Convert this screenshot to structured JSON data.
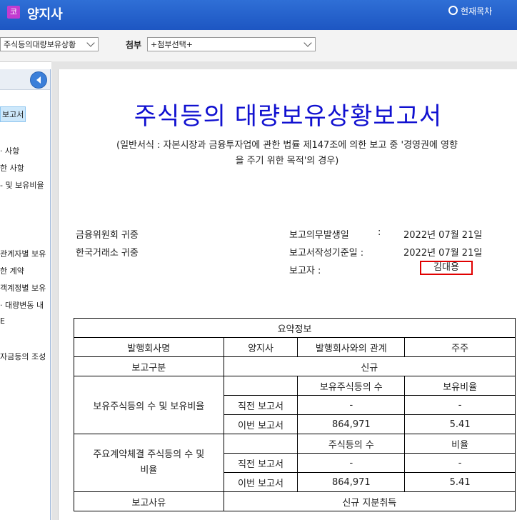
{
  "header": {
    "logo_char": "코",
    "company": "양지사",
    "toc_label": "현재목차"
  },
  "toolbar": {
    "doc_select": "주식등의대량보유상황",
    "attach_label": "첨부",
    "attach_select": "+첨부선택+"
  },
  "sidebar": {
    "items": [
      "보고서",
      "· 사항",
      "한 사항",
      "- 및 보유비율",
      "관계자별 보유",
      "한 계약",
      "객계정별 보유",
      "· 대량변동 내",
      "E",
      "자금등의 조성"
    ]
  },
  "document": {
    "title": "주식등의 대량보유상황보고서",
    "subtitle_line1": "(일반서식 : 자본시장과 금융투자업에 관한 법률 제147조에 의한 보고 중 '경영권에 영향",
    "subtitle_line2": "을 주기 위한 목적'의 경우)",
    "addressee1": "금융위원회 귀중",
    "addressee2": "한국거래소 귀중",
    "obligation_date_label": "보고의무발생일",
    "obligation_colon": ":",
    "obligation_date": "2022년 07월 21일",
    "base_date_label": "보고서작성기준일 :",
    "base_date": "2022년 07월 21일",
    "reporter_label": "보고자 :",
    "reporter": "김대용"
  },
  "summary": {
    "caption": "요약정보",
    "h_issuer": "발행회사명",
    "issuer": "양지사",
    "h_relation": "발행회사와의 관계",
    "relation": "주주",
    "h_report_type": "보고구분",
    "report_type": "신규",
    "holding_label": "보유주식등의 수 및 보유비율",
    "h_holding_count": "보유주식등의 수",
    "h_holding_ratio": "보유비율",
    "prev_report": "직전 보고서",
    "curr_report": "이번 보고서",
    "prev_count": "-",
    "prev_ratio": "-",
    "curr_count": "864,971",
    "curr_ratio": "5.41",
    "contract_label_1": "주요계약체결 주식등의 수 및",
    "contract_label_2": "비율",
    "h_contract_count": "주식등의 수",
    "h_contract_ratio": "비율",
    "c_prev_report": "직전 보고서",
    "c_curr_report": "이번 보고서",
    "c_prev_count": "-",
    "c_prev_ratio": "-",
    "c_curr_count": "864,971",
    "c_curr_ratio": "5.41",
    "h_reason": "보고사유",
    "reason": "신규 지분취득"
  }
}
